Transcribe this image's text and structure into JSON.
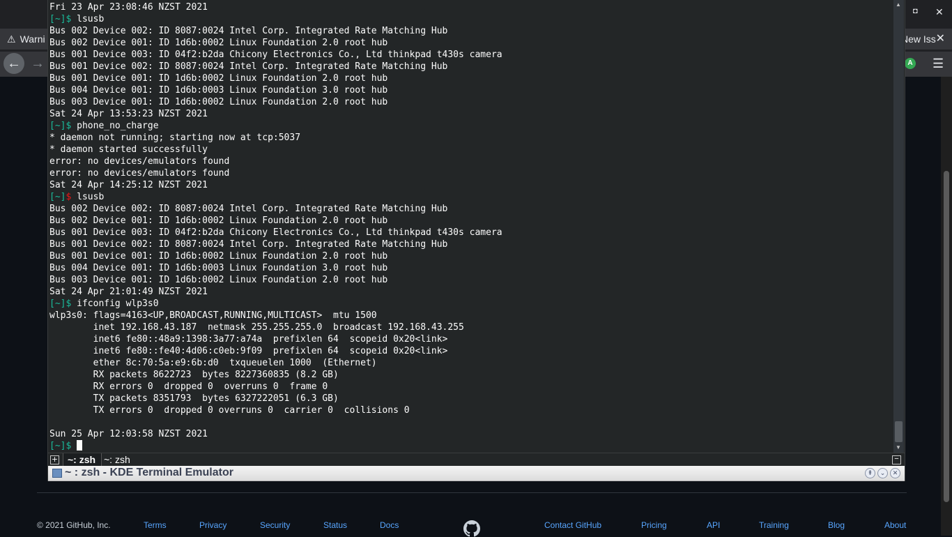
{
  "browser": {
    "tab_left_label": "Warni",
    "tab_left_icon": "warning-icon",
    "tab_right_label": "New Iss",
    "tab_close_glyph": "✕",
    "back_glyph": "←",
    "forward_glyph": "→",
    "profile_initial": "A",
    "menu_glyph": "☰",
    "window_min_glyph": "◘",
    "window_close_glyph": "✕"
  },
  "terminal": {
    "lines": [
      {
        "t": "Fri 23 Apr 23:08:46 NZST 2021"
      },
      {
        "cmd": "lsusb",
        "status": "ok"
      },
      {
        "t": "Bus 002 Device 002: ID 8087:0024 Intel Corp. Integrated Rate Matching Hub"
      },
      {
        "t": "Bus 002 Device 001: ID 1d6b:0002 Linux Foundation 2.0 root hub"
      },
      {
        "t": "Bus 001 Device 003: ID 04f2:b2da Chicony Electronics Co., Ltd thinkpad t430s camera"
      },
      {
        "t": "Bus 001 Device 002: ID 8087:0024 Intel Corp. Integrated Rate Matching Hub"
      },
      {
        "t": "Bus 001 Device 001: ID 1d6b:0002 Linux Foundation 2.0 root hub"
      },
      {
        "t": "Bus 004 Device 001: ID 1d6b:0003 Linux Foundation 3.0 root hub"
      },
      {
        "t": "Bus 003 Device 001: ID 1d6b:0002 Linux Foundation 2.0 root hub"
      },
      {
        "t": "Sat 24 Apr 13:53:23 NZST 2021"
      },
      {
        "cmd": "phone_no_charge",
        "status": "ok"
      },
      {
        "t": "* daemon not running; starting now at tcp:5037"
      },
      {
        "t": "* daemon started successfully"
      },
      {
        "t": "error: no devices/emulators found"
      },
      {
        "t": "error: no devices/emulators found"
      },
      {
        "t": "Sat 24 Apr 14:25:12 NZST 2021"
      },
      {
        "cmd": "lsusb",
        "status": "err"
      },
      {
        "t": "Bus 002 Device 002: ID 8087:0024 Intel Corp. Integrated Rate Matching Hub"
      },
      {
        "t": "Bus 002 Device 001: ID 1d6b:0002 Linux Foundation 2.0 root hub"
      },
      {
        "t": "Bus 001 Device 003: ID 04f2:b2da Chicony Electronics Co., Ltd thinkpad t430s camera"
      },
      {
        "t": "Bus 001 Device 002: ID 8087:0024 Intel Corp. Integrated Rate Matching Hub"
      },
      {
        "t": "Bus 001 Device 001: ID 1d6b:0002 Linux Foundation 2.0 root hub"
      },
      {
        "t": "Bus 004 Device 001: ID 1d6b:0003 Linux Foundation 3.0 root hub"
      },
      {
        "t": "Bus 003 Device 001: ID 1d6b:0002 Linux Foundation 2.0 root hub"
      },
      {
        "t": "Sat 24 Apr 21:01:49 NZST 2021"
      },
      {
        "cmd": "ifconfig wlp3s0",
        "status": "ok"
      },
      {
        "t": "wlp3s0: flags=4163<UP,BROADCAST,RUNNING,MULTICAST>  mtu 1500"
      },
      {
        "t": "        inet 192.168.43.187  netmask 255.255.255.0  broadcast 192.168.43.255"
      },
      {
        "t": "        inet6 fe80::48a9:1398:3a77:a74a  prefixlen 64  scopeid 0x20<link>"
      },
      {
        "t": "        inet6 fe80::fe40:4d06:c0eb:9f09  prefixlen 64  scopeid 0x20<link>"
      },
      {
        "t": "        ether 8c:70:5a:e9:6b:d0  txqueuelen 1000  (Ethernet)"
      },
      {
        "t": "        RX packets 8622723  bytes 8227360835 (8.2 GB)"
      },
      {
        "t": "        RX errors 0  dropped 0  overruns 0  frame 0"
      },
      {
        "t": "        TX packets 8351793  bytes 6327222051 (6.3 GB)"
      },
      {
        "t": "        TX errors 0  dropped 0 overruns 0  carrier 0  collisions 0"
      },
      {
        "t": ""
      },
      {
        "t": "Sun 25 Apr 12:03:58 NZST 2021"
      },
      {
        "cmd": "",
        "status": "ok",
        "cursor": true
      }
    ],
    "prompt_dir": "[~]",
    "prompt_symbol": "$",
    "tabs": {
      "new_tab_glyph": "+",
      "active_label": "~: zsh",
      "inactive_label": "~: zsh",
      "close_glyph": "−"
    },
    "title": "~ : zsh - KDE Terminal Emulator",
    "title_buttons": [
      "⇞",
      "⌄",
      "✕"
    ],
    "colors": {
      "background": "#232627",
      "text": "#fcfcfc",
      "prompt": "#1abc9c",
      "prompt_error": "#ed1515"
    }
  },
  "footer": {
    "copyright": "© 2021 GitHub, Inc.",
    "links": [
      "Terms",
      "Privacy",
      "Security",
      "Status",
      "Docs",
      "Contact GitHub",
      "Pricing",
      "API",
      "Training",
      "Blog",
      "About"
    ],
    "logo_icon": "github-logo-icon"
  }
}
